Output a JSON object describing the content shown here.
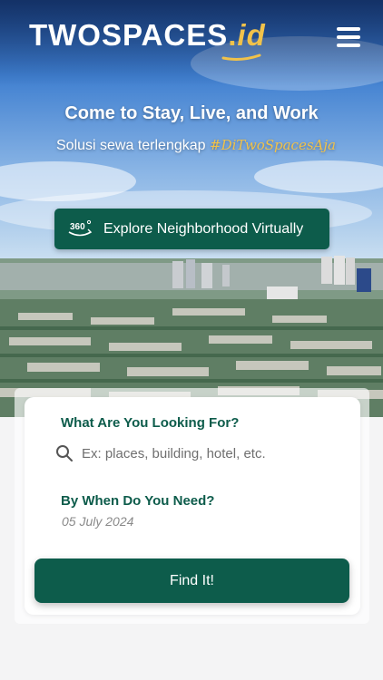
{
  "brand": {
    "name": "TWOSPACES",
    "dot": ".",
    "tld": "id"
  },
  "header": {
    "menu_icon": "hamburger-menu-icon"
  },
  "hero": {
    "title": "Come to Stay, Live, and Work",
    "subtitle": "Solusi sewa terlengkap",
    "hashtag": "#DiTwoSpacesAja"
  },
  "explore_button": {
    "icon": "360-view-icon",
    "label": "Explore Neighborhood Virtually"
  },
  "search_form": {
    "looking_for_label": "What Are You Looking For?",
    "search_icon": "search-icon",
    "search_placeholder": "Ex: places, building, hotel, etc.",
    "when_label": "By When Do You Need?",
    "date_value": "05 July 2024",
    "submit_label": "Find It!"
  },
  "colors": {
    "primary": "#0d5c4b",
    "accent": "#f1c24a"
  }
}
